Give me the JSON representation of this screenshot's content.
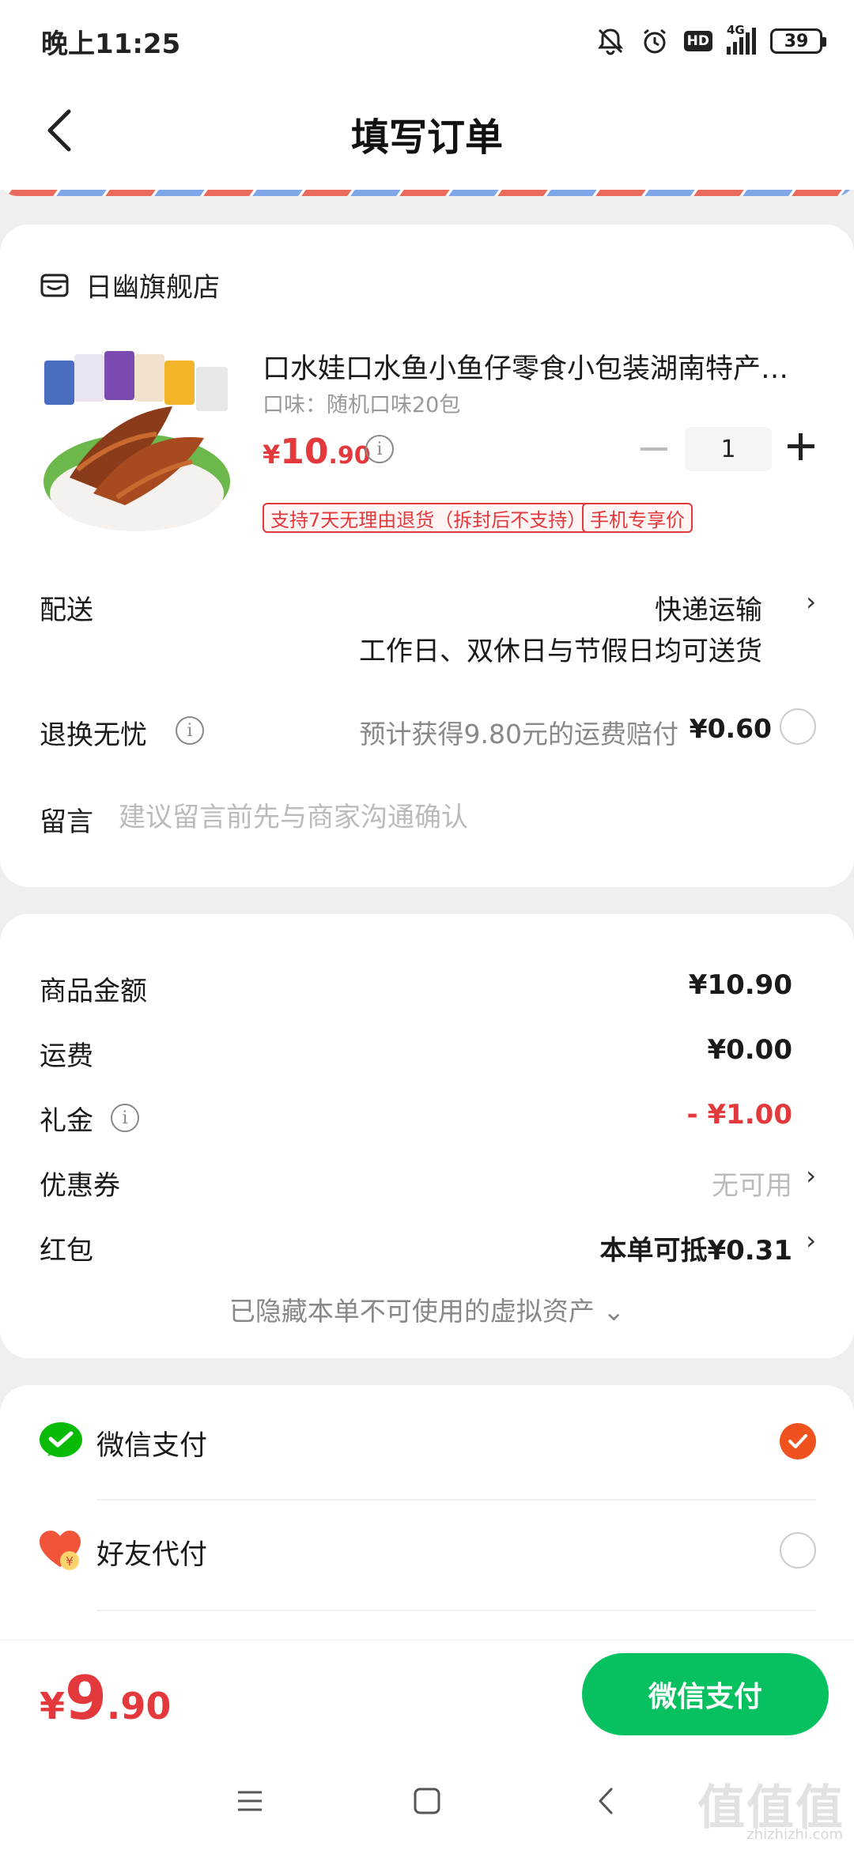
{
  "status_bar": {
    "time": "晚上11:25",
    "network": "4G",
    "hd": "HD",
    "battery": "39"
  },
  "header": {
    "title": "填写订单"
  },
  "store": {
    "name": "日幽旗舰店"
  },
  "product": {
    "title": "口水娃口水鱼小鱼仔零食小包装湖南特产…",
    "flavor": "口味：随机口味20包",
    "price_currency": "¥",
    "price_int": "10",
    "price_dec": ".90",
    "quantity": "1",
    "tags": [
      "支持7天无理由退货（拆封后不支持）",
      "手机专享价"
    ]
  },
  "delivery": {
    "label": "配送",
    "method": "快递运输",
    "note": "工作日、双休日与节假日均可送货"
  },
  "return_insurance": {
    "label": "退换无忧",
    "desc": "预计获得9.80元的运费赔付",
    "price": "¥0.60"
  },
  "message": {
    "label": "留言",
    "placeholder": "建议留言前先与商家沟通确认"
  },
  "summary": {
    "rows": [
      {
        "label": "商品金额",
        "value": "¥10.90"
      },
      {
        "label": "运费",
        "value": "¥0.00"
      },
      {
        "label": "礼金",
        "value": "- ¥1.00"
      },
      {
        "label": "优惠券",
        "value": "无可用"
      },
      {
        "label": "红包",
        "value": "本单可抵¥0.31"
      }
    ],
    "hidden_note": "已隐藏本单不可使用的虚拟资产 ⌄"
  },
  "payment": {
    "options": [
      {
        "label": "微信支付",
        "selected": true
      },
      {
        "label": "好友代付",
        "selected": false
      }
    ]
  },
  "bottom": {
    "currency": "¥",
    "total_int": "9",
    "total_dec": ".90",
    "pay_button": "微信支付"
  },
  "watermark": {
    "text": "值值值",
    "sub": "zhizhizhi.com"
  },
  "colors": {
    "accent_red": "#e4393c",
    "wechat_green": "#07c160",
    "radio_orange": "#f0521f"
  }
}
